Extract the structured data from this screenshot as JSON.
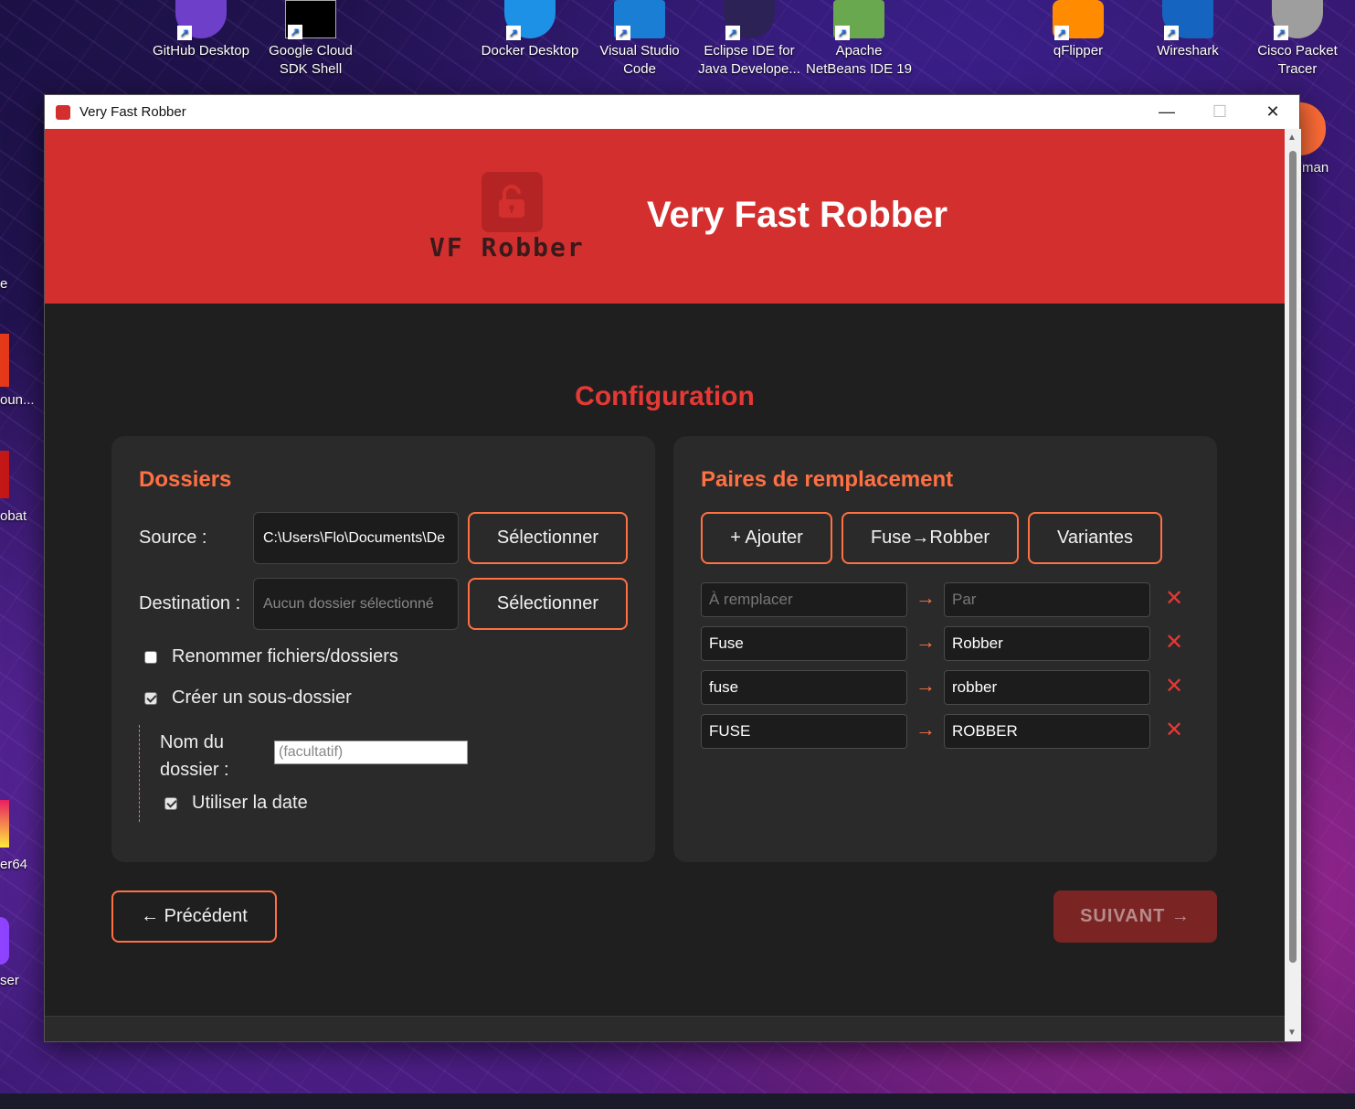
{
  "desktop": {
    "icons": [
      {
        "label1": "GitHub Desktop",
        "label2": "",
        "color": "#6e40c9"
      },
      {
        "label1": "Google Cloud",
        "label2": "SDK Shell",
        "color": "#000000"
      },
      {
        "label1": "Docker Desktop",
        "label2": "",
        "color": "#1d91e6"
      },
      {
        "label1": "Visual Studio",
        "label2": "Code",
        "color": "#1a7fd4"
      },
      {
        "label1": "Eclipse IDE for",
        "label2": "Java Develope...",
        "color": "#2c2255"
      },
      {
        "label1": "Apache",
        "label2": "NetBeans IDE 19",
        "color": "#6aa84f"
      },
      {
        "label1": "qFlipper",
        "label2": "",
        "color": "#ff8c00"
      },
      {
        "label1": "Wireshark",
        "label2": "",
        "color": "#1565c0"
      },
      {
        "label1": "Cisco Packet",
        "label2": "Tracer",
        "color": "#9e9e9e"
      }
    ],
    "left_labels": [
      "e",
      "oun...",
      "obat",
      "er64",
      "ser"
    ],
    "right_label": "man"
  },
  "window": {
    "title": "Very Fast Robber",
    "minimize": "—",
    "maximize": "☐",
    "close": "✕"
  },
  "header": {
    "logo_text": "VF Robber",
    "app_title": "Very Fast Robber"
  },
  "section_title": "Configuration",
  "folders": {
    "title": "Dossiers",
    "source_label": "Source :",
    "source_value": "C:\\Users\\Flo\\Documents\\De",
    "destination_label": "Destination :",
    "destination_placeholder": "Aucun dossier sélectionné",
    "select_label": "Sélectionner",
    "rename_label": "Renommer fichiers/dossiers",
    "rename_checked": false,
    "subfolder_label": "Créer un sous-dossier",
    "subfolder_checked": true,
    "folder_name_label_1": "Nom du",
    "folder_name_label_2": "dossier :",
    "folder_name_placeholder": "(facultatif)",
    "use_date_label": "Utiliser la date",
    "use_date_checked": true
  },
  "pairs": {
    "title": "Paires de remplacement",
    "add_label": "+ Ajouter",
    "preset_label": "Fuse→Robber",
    "variants_label": "Variantes",
    "placeholder_from": "À remplacer",
    "placeholder_to": "Par",
    "arrow": "→",
    "delete": "✕",
    "rows": [
      {
        "from": "Fuse",
        "to": "Robber"
      },
      {
        "from": "fuse",
        "to": "robber"
      },
      {
        "from": "FUSE",
        "to": "ROBBER"
      }
    ]
  },
  "nav": {
    "prev_label": "← Précédent",
    "next_label": "SUIVANT →"
  }
}
